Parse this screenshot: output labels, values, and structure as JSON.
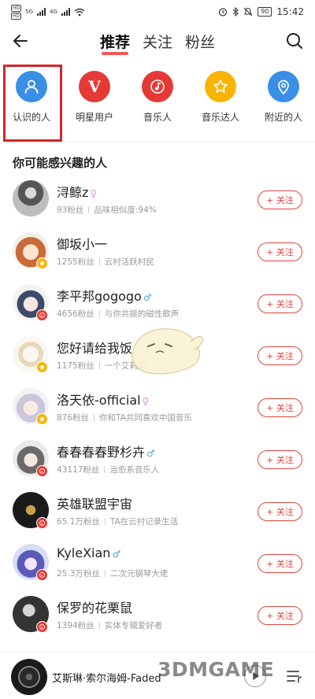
{
  "status_bar": {
    "sim1": "HD",
    "sim2": "HD",
    "net1": "5G",
    "net2": "4G",
    "battery": "90",
    "time": "15:42"
  },
  "nav": {
    "tabs": [
      {
        "label": "推荐",
        "active": true
      },
      {
        "label": "关注",
        "active": false
      },
      {
        "label": "粉丝",
        "active": false
      }
    ]
  },
  "categories": [
    {
      "label": "认识的人",
      "icon": "person-icon",
      "color": "#3a8ee6"
    },
    {
      "label": "明星用户",
      "icon": "v-badge-icon",
      "color": "#e53935"
    },
    {
      "label": "音乐人",
      "icon": "music-note-icon",
      "color": "#e53935"
    },
    {
      "label": "音乐达人",
      "icon": "star-icon",
      "color": "#f7b500"
    },
    {
      "label": "附近的人",
      "icon": "location-pin-icon",
      "color": "#3a8ee6"
    }
  ],
  "section_title": "你可能感兴趣的人",
  "follow_label": "+ 关注",
  "users": [
    {
      "name": "浔鲸z",
      "gender": "♀",
      "fans": "93粉丝",
      "desc": "品味相似度:94%",
      "badge": ""
    },
    {
      "name": "御坂小一",
      "gender": "",
      "fans": "1255粉丝",
      "desc": "云村活跃村民",
      "badge": "star"
    },
    {
      "name": "李平邦gogogo",
      "gender": "♂",
      "fans": "4656粉丝",
      "desc": "与你共振的磁性歌声",
      "badge": "music"
    },
    {
      "name": "您好请给我饭",
      "gender": "",
      "fans": "1175粉丝",
      "desc": "一个艾莉厨",
      "badge": "star"
    },
    {
      "name": "洛天依-official",
      "gender": "♀",
      "fans": "876粉丝",
      "desc": "你和TA共同喜欢中国音乐",
      "badge": "star"
    },
    {
      "name": "春春春春野杉卉",
      "gender": "♂",
      "fans": "43117粉丝",
      "desc": "治愈系音乐人",
      "badge": "music"
    },
    {
      "name": "英雄联盟宇宙",
      "gender": "",
      "fans": "65.1万粉丝",
      "desc": "TA在云村记录生活",
      "badge": "music"
    },
    {
      "name": "KyleXian",
      "gender": "♂",
      "fans": "25.3万粉丝",
      "desc": "二次元钢琴大佬",
      "badge": "music"
    },
    {
      "name": "保罗的花栗鼠",
      "gender": "",
      "fans": "1394粉丝",
      "desc": "实体专辑爱好者",
      "badge": "music"
    }
  ],
  "player": {
    "title": "艾斯琳·索尔海姆-Faded"
  },
  "watermark": "3DMGAME"
}
